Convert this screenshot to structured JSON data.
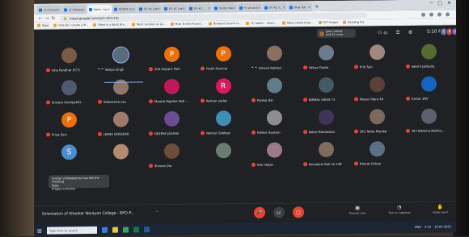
{
  "browser": {
    "tabs": [
      {
        "label": "(1) Cl Google...",
        "active": false
      },
      {
        "label": "(1) WhatsApp",
        "active": false
      },
      {
        "label": "Meet - hiv...",
        "active": true
      },
      {
        "label": "MYNOT Vi...",
        "active": false
      },
      {
        "label": "(F) 4C Lok...",
        "active": false
      },
      {
        "label": "(F) 4C Lok...",
        "active": false
      },
      {
        "label": "(F) 4C...",
        "active": false
      },
      {
        "label": "Visitor Man...",
        "active": false
      },
      {
        "label": "Fc aft and ...",
        "active": false
      },
      {
        "label": "(F) 4C T...",
        "active": false
      },
      {
        "label": "New Tab",
        "active": false
      }
    ],
    "new_tab": "+",
    "window_controls": [
      "─",
      "□",
      "✕"
    ],
    "url": "meet.google.com/qvh-dsrs-trp",
    "bookmarks": [
      "Apps",
      "How do I create a M...",
      "What Is a Work Bre...",
      "Work location at ev...",
      "How To Get Project...",
      "Browsed Search O...",
      "(3) admin - Searc...",
      "https://www.hoop...",
      "PCT Helper",
      "Reading list"
    ]
  },
  "meet": {
    "presenting": {
      "line1": "gauri rathod",
      "line2": "and 61 more"
    },
    "participant_count": "62",
    "clock": "5:10 PM",
    "self_avatars": [
      "S",
      "R",
      "D"
    ],
    "participants": [
      {
        "name": "Isha Pandhar (ICT)",
        "initial": "",
        "mic": "muted"
      },
      {
        "name": "Aditya Singh",
        "initial": "",
        "mic": "speaking"
      },
      {
        "name": "204 Gayatri Patil",
        "initial": "P",
        "mic": "muted"
      },
      {
        "name": "Pratik Sharma",
        "initial": "P",
        "mic": "muted"
      },
      {
        "name": "Dinesh Rathod",
        "initial": "",
        "mic": "speaking"
      },
      {
        "name": "Aditya Gupta",
        "initial": "",
        "mic": "muted"
      },
      {
        "name": "Priti Sah",
        "initial": "",
        "mic": "muted"
      },
      {
        "name": "Sakshi Jaihodia",
        "initial": "",
        "mic": "muted"
      },
      {
        "name": "Shivam Pandey461",
        "initial": "",
        "mic": "muted"
      },
      {
        "name": "Debosmita sau",
        "initial": "",
        "mic": "muted"
      },
      {
        "name": "Mamta Rajbhar Roll ...",
        "initial": "",
        "mic": "muted"
      },
      {
        "name": "Roshan yadav",
        "initial": "R",
        "mic": "muted"
      },
      {
        "name": "Pankaj Bar",
        "initial": "",
        "mic": "muted"
      },
      {
        "name": "NIRMAL VIKAS 72",
        "initial": "",
        "mic": "muted"
      },
      {
        "name": "Mayuri Nare 49",
        "initial": "",
        "mic": "muted"
      },
      {
        "name": "Tushar 28V",
        "initial": "",
        "mic": "muted"
      },
      {
        "name": "Priya Soni",
        "initial": "P",
        "mic": "muted"
      },
      {
        "name": "LEENA GOVEKAR",
        "initial": "",
        "mic": "muted"
      },
      {
        "name": "DEEPAK JADHAV",
        "initial": "",
        "mic": "muted"
      },
      {
        "name": "Vaibhut Siddiqui",
        "initial": "",
        "mic": "muted"
      },
      {
        "name": "Pallavi Gautam",
        "initial": "",
        "mic": "muted"
      },
      {
        "name": "Bakhi Mandavkar",
        "initial": "",
        "mic": "muted"
      },
      {
        "name": "S61 Neha Mondal",
        "initial": "",
        "mic": "muted"
      },
      {
        "name": "393 Mahima Mukhrj...",
        "initial": "",
        "mic": "muted"
      },
      {
        "name": "",
        "initial": "S",
        "mic": "none"
      },
      {
        "name": "",
        "initial": "",
        "mic": "none"
      },
      {
        "name": "Shivam Jha",
        "initial": "",
        "mic": "muted"
      },
      {
        "name": "",
        "initial": "",
        "mic": "none"
      },
      {
        "name": "Ritu Yadav",
        "initial": "",
        "mic": "muted"
      },
      {
        "name": "Komaljani Roll no 148",
        "initial": "",
        "mic": "muted"
      },
      {
        "name": "Bharat Dubey",
        "initial": "",
        "mic": "muted"
      }
    ],
    "notification": {
      "line1": "Snehal Vishwakarma has left the meeting",
      "line2": "Tejas",
      "line3": "Pragya surname"
    },
    "meeting_title": "Orientation of Shankar Narayan College - BPO-P...",
    "meeting_chevron": "⌃",
    "controls": {
      "mic": "🎤",
      "cam": "▢",
      "captions": "CC",
      "hangup": "☎"
    },
    "right_controls": [
      {
        "icon": "▣",
        "label": "Present now"
      },
      {
        "icon": "◔",
        "label": "Turn on captions"
      },
      {
        "icon": "✋",
        "label": "Raise hand"
      }
    ]
  },
  "taskbar": {
    "start": "⊞",
    "search_placeholder": "Type here to search",
    "tray_time": "5:10",
    "tray_date": "16-05-2022",
    "tray_lang": "ENG"
  }
}
